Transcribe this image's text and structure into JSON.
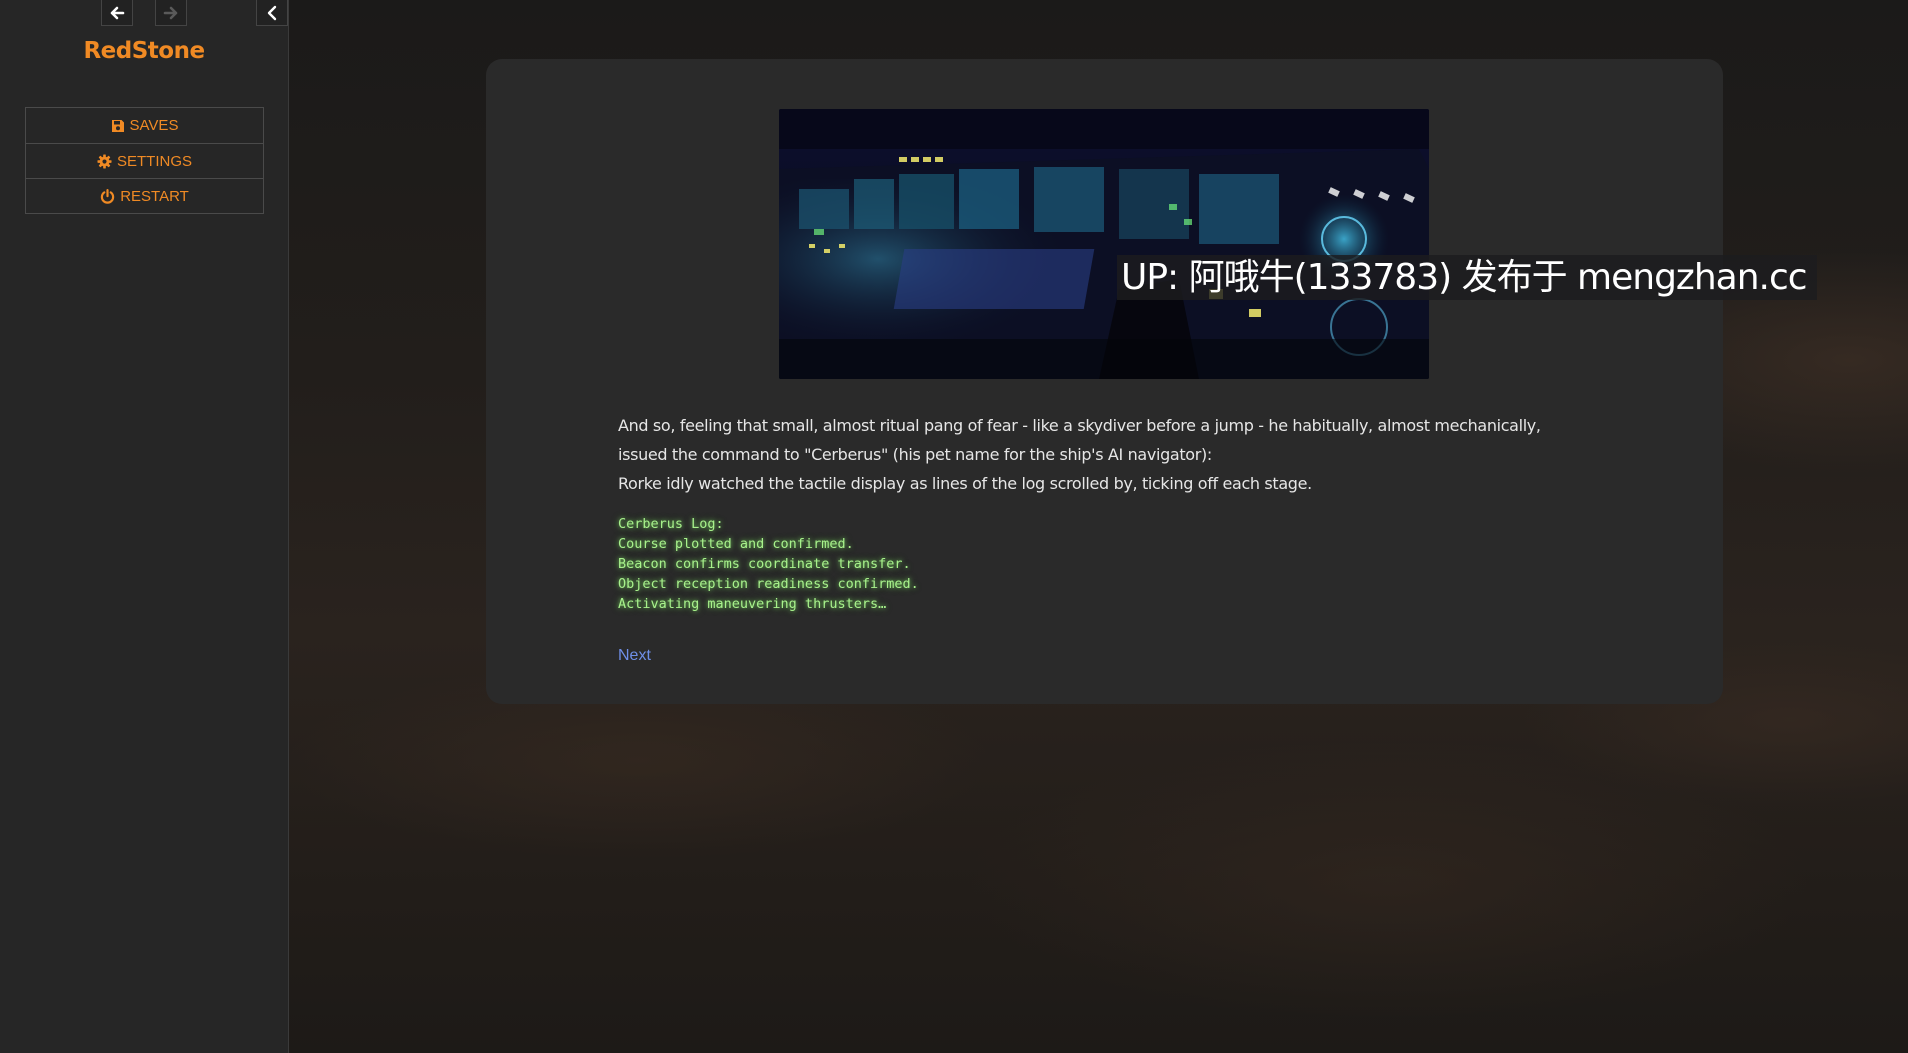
{
  "sidebar": {
    "story_title": "RedStone",
    "menu": [
      {
        "label": "SAVES",
        "icon": "floppy-disk-icon"
      },
      {
        "label": "SETTINGS",
        "icon": "gear-icon"
      },
      {
        "label": "RESTART",
        "icon": "power-icon"
      }
    ]
  },
  "passage": {
    "watermark": "UP: 阿哦牛(133783) 发布于 mengzhan.cc",
    "paragraph_1": "And so, feeling that small, almost ritual pang of fear - like a skydiver before a jump - he habitually, almost mechanically, issued the command to \"Cerberus\" (his pet name for the ship's AI navigator):",
    "paragraph_2": "Rorke idly watched the tactile display as lines of the log scrolled by, ticking off each stage.",
    "log": [
      "Cerberus Log:",
      "Course plotted and confirmed.",
      "Beacon confirms coordinate transfer.",
      "Object reception readiness confirmed.",
      "Activating maneuvering thrusters…"
    ],
    "next_link": "Next"
  },
  "colors": {
    "accent": "#f08a24",
    "link": "#6f8fe8",
    "log_text": "#a8f28c",
    "panel": "#2a2a2a",
    "sidebar": "#262626"
  }
}
